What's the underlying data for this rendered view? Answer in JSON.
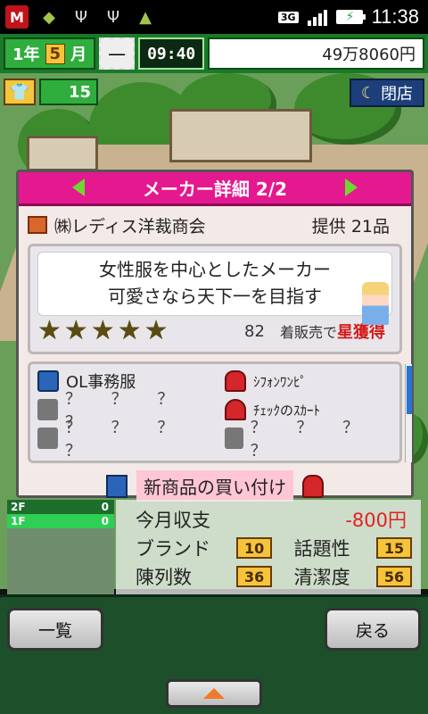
{
  "status_bar": {
    "network": "3G",
    "time": "11:38"
  },
  "top_bar": {
    "year": "1年",
    "month": "5",
    "month_suffix": "月",
    "clock_time": "09:40",
    "money": "49万8060円"
  },
  "hud": {
    "staff_count": "15",
    "store_status": "閉店"
  },
  "dialog": {
    "title": "メーカー詳細 2/2",
    "maker_name": "㈱レディス洋裁商会",
    "offer": "提供 21品",
    "description_line1": "女性服を中心としたメーカー",
    "description_line2": "可愛さなら天下一を目指す",
    "rating_stars": 5,
    "popularity": "82",
    "popularity_label": "着販売で",
    "popularity_rank": "星獲得",
    "items": [
      {
        "name": "OL事務服",
        "icon": "blazer-icon"
      },
      {
        "name": "ｼﾌｫﾝﾜﾝﾋﾟ",
        "icon": "dress-icon"
      },
      {
        "name": "？ ？ ？ ？",
        "icon": "unknown-icon"
      },
      {
        "name": "ﾁｪｯｸのｽｶｰﾄ",
        "icon": "skirt-icon"
      },
      {
        "name": "？ ？ ？ ？",
        "icon": "unknown-icon"
      },
      {
        "name": "？ ？ ？ ？",
        "icon": "unknown-icon"
      }
    ],
    "buy_button": "新商品の買い付け"
  },
  "floors": {
    "f2": "2F",
    "f1": "1F",
    "f2_count": "0",
    "f1_count": "0"
  },
  "stats": {
    "income_label": "今月収支",
    "income_value": "-800円",
    "brand_label": "ブランド",
    "brand_value": "10",
    "topic_label": "話題性",
    "topic_value": "15",
    "display_label": "陳列数",
    "display_value": "36",
    "clean_label": "清潔度",
    "clean_value": "56"
  },
  "buttons": {
    "list": "一覧",
    "back": "戻る"
  },
  "colors": {
    "title_bar": "#e4188f",
    "accent_green": "#2fae3e",
    "negative": "#e02222"
  }
}
